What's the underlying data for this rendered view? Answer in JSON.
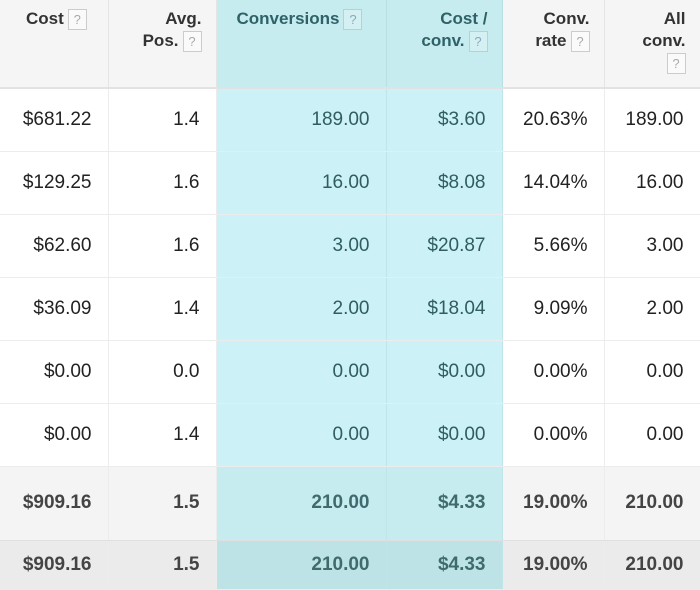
{
  "help_icon_label": "?",
  "headers": [
    {
      "line1": "Cost",
      "line2": ""
    },
    {
      "line1": "Avg.",
      "line2": "Pos."
    },
    {
      "line1": "Conversions",
      "line2": ""
    },
    {
      "line1": "Cost /",
      "line2": "conv."
    },
    {
      "line1": "Conv.",
      "line2": "rate"
    },
    {
      "line1": "All",
      "line2": "conv."
    }
  ],
  "rows": [
    [
      "$681.22",
      "1.4",
      "189.00",
      "$3.60",
      "20.63%",
      "189.00"
    ],
    [
      "$129.25",
      "1.6",
      "16.00",
      "$8.08",
      "14.04%",
      "16.00"
    ],
    [
      "$62.60",
      "1.6",
      "3.00",
      "$20.87",
      "5.66%",
      "3.00"
    ],
    [
      "$36.09",
      "1.4",
      "2.00",
      "$18.04",
      "9.09%",
      "2.00"
    ],
    [
      "$0.00",
      "0.0",
      "0.00",
      "$0.00",
      "0.00%",
      "0.00"
    ],
    [
      "$0.00",
      "1.4",
      "0.00",
      "$0.00",
      "0.00%",
      "0.00"
    ]
  ],
  "totals": [
    [
      "$909.16",
      "1.5",
      "210.00",
      "$4.33",
      "19.00%",
      "210.00"
    ],
    [
      "$909.16",
      "1.5",
      "210.00",
      "$4.33",
      "19.00%",
      "210.00"
    ]
  ],
  "colors": {
    "highlight_column": "#ccf1f6",
    "header_bg": "#f5f5f5"
  }
}
